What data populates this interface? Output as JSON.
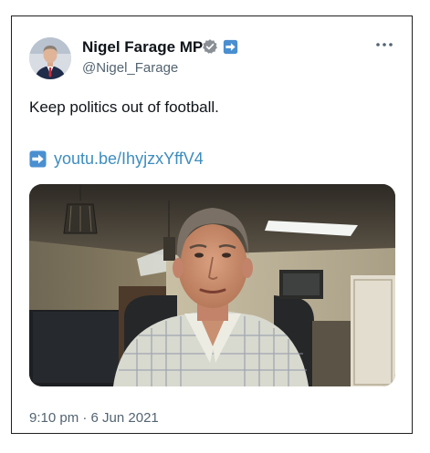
{
  "tweet": {
    "author": {
      "display_name": "Nigel Farage MP",
      "handle": "@Nigel_Farage",
      "avatar_icon": "profile-photo",
      "verified_icon": "verified-badge-icon",
      "flag_icon": "arrow-right-flag-icon"
    },
    "more_icon": "more-options-icon",
    "text": "Keep politics out of football.",
    "link": {
      "icon": "arrow-right-box-icon",
      "text": "youtube/IhyjzxYffV4",
      "display": "youtu.be/IhyjzxYffV4"
    },
    "media": {
      "type": "video-thumbnail"
    },
    "timestamp": "9:10 pm · 6 Jun 2021"
  },
  "colors": {
    "text_primary": "#0f1419",
    "text_secondary": "#536471",
    "link": "#3d8dbf",
    "badge_grey": "#8a8f96",
    "flag_blue": "#4a8fd0",
    "frame_border": "#202020"
  }
}
